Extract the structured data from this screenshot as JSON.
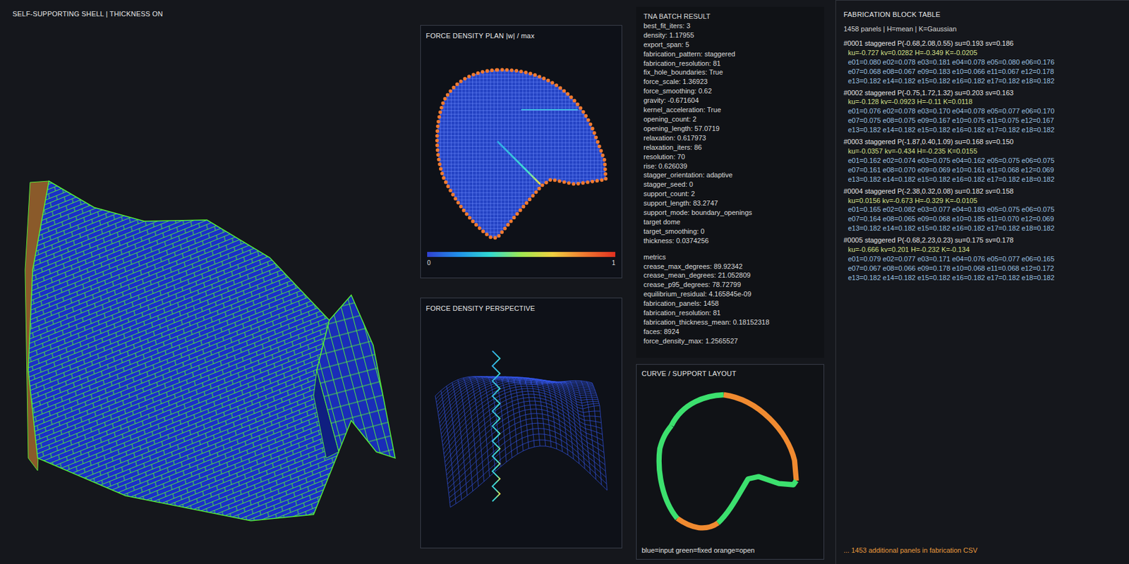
{
  "shell": {
    "title": "SELF-SUPPORTING SHELL | THICKNESS ON"
  },
  "plan": {
    "title": "FORCE DENSITY PLAN |w| / max",
    "scale_min": "0",
    "scale_max": "1"
  },
  "perspective": {
    "title": "FORCE DENSITY PERSPECTIVE"
  },
  "batch": {
    "title": "TNA BATCH RESULT",
    "params": [
      "best_fit_iters: 3",
      "density: 1.17955",
      "export_span: 5",
      "fabrication_pattern: staggered",
      "fabrication_resolution: 81",
      "fix_hole_boundaries: True",
      "force_scale: 1.36923",
      "force_smoothing: 0.62",
      "gravity: -0.671604",
      "kernel_acceleration: True",
      "opening_count: 2",
      "opening_length: 57.0719",
      "relaxation: 0.617973",
      "relaxation_iters: 86",
      "resolution: 70",
      "rise: 0.626039",
      "stagger_orientation: adaptive",
      "stagger_seed: 0",
      "support_count: 2",
      "support_length: 83.2747",
      "support_mode: boundary_openings",
      "target dome",
      "target_smoothing: 0",
      "thickness: 0.0374256"
    ],
    "metrics_title": "metrics",
    "metrics": [
      "crease_max_degrees: 89.92342",
      "crease_mean_degrees: 21.052809",
      "crease_p95_degrees: 78.72799",
      "equilibrium_residual: 4.165845e-09",
      "fabrication_panels: 1458",
      "fabrication_resolution: 81",
      "fabrication_thickness_mean: 0.18152318",
      "faces: 8924",
      "force_density_max: 1.2565527"
    ]
  },
  "curve": {
    "title": "CURVE / SUPPORT LAYOUT",
    "segments": [
      {
        "kind": "fixed",
        "color": "#3ce06e"
      },
      {
        "kind": "open",
        "color": "#f08a30"
      },
      {
        "kind": "fixed",
        "color": "#3ce06e"
      },
      {
        "kind": "open",
        "color": "#f08a30"
      },
      {
        "kind": "fixed",
        "color": "#3ce06e"
      }
    ],
    "legend": "blue=input green=fixed orange=open"
  },
  "fabrication": {
    "title": "FABRICATION BLOCK TABLE",
    "summary": "1458 panels | H=mean | K=Gaussian",
    "panels": [
      {
        "header": "#0001 staggered P(-0.68,2.08,0.55) su=0.193 sv=0.186",
        "curvature": "ku=-0.727 kv=0.0282 H=-0.349 K=-0.0205",
        "edges": [
          "e01=0.080 e02=0.078 e03=0.181 e04=0.078 e05=0.080 e06=0.176",
          "e07=0.068 e08=0.067 e09=0.183 e10=0.066 e11=0.067 e12=0.178",
          "e13=0.182 e14=0.182 e15=0.182 e16=0.182 e17=0.182 e18=0.182"
        ]
      },
      {
        "header": "#0002 staggered P(-0.75,1.72,1.32) su=0.203 sv=0.163",
        "curvature": "ku=-0.128 kv=-0.0923 H=-0.11 K=0.0118",
        "edges": [
          "e01=0.076 e02=0.078 e03=0.170 e04=0.078 e05=0.077 e06=0.170",
          "e07=0.075 e08=0.075 e09=0.167 e10=0.075 e11=0.075 e12=0.167",
          "e13=0.182 e14=0.182 e15=0.182 e16=0.182 e17=0.182 e18=0.182"
        ]
      },
      {
        "header": "#0003 staggered P(-1.87,0.40,1.09) su=0.168 sv=0.150",
        "curvature": "ku=-0.0357 kv=-0.434 H=-0.235 K=0.0155",
        "edges": [
          "e01=0.162 e02=0.074 e03=0.075 e04=0.162 e05=0.075 e06=0.075",
          "e07=0.161 e08=0.070 e09=0.069 e10=0.161 e11=0.068 e12=0.069",
          "e13=0.182 e14=0.182 e15=0.182 e16=0.182 e17=0.182 e18=0.182"
        ]
      },
      {
        "header": "#0004 staggered P(-2.38,0.32,0.08) su=0.182 sv=0.158",
        "curvature": "ku=0.0156 kv=-0.673 H=-0.329 K=-0.0105",
        "edges": [
          "e01=0.165 e02=0.082 e03=0.077 e04=0.183 e05=0.075 e06=0.075",
          "e07=0.164 e08=0.065 e09=0.068 e10=0.185 e11=0.070 e12=0.069",
          "e13=0.182 e14=0.182 e15=0.182 e16=0.182 e17=0.182 e18=0.182"
        ]
      },
      {
        "header": "#0005 staggered P(-0.68,2.23,0.23) su=0.175 sv=0.178",
        "curvature": "ku=-0.666 kv=0.201 H=-0.232 K=-0.134",
        "edges": [
          "e01=0.079 e02=0.077 e03=0.171 e04=0.076 e05=0.077 e06=0.165",
          "e07=0.067 e08=0.066 e09=0.178 e10=0.068 e11=0.068 e12=0.172",
          "e13=0.182 e14=0.182 e15=0.182 e16=0.182 e17=0.182 e18=0.182"
        ]
      }
    ],
    "footer": "... 1453 additional panels in fabrication CSV"
  }
}
